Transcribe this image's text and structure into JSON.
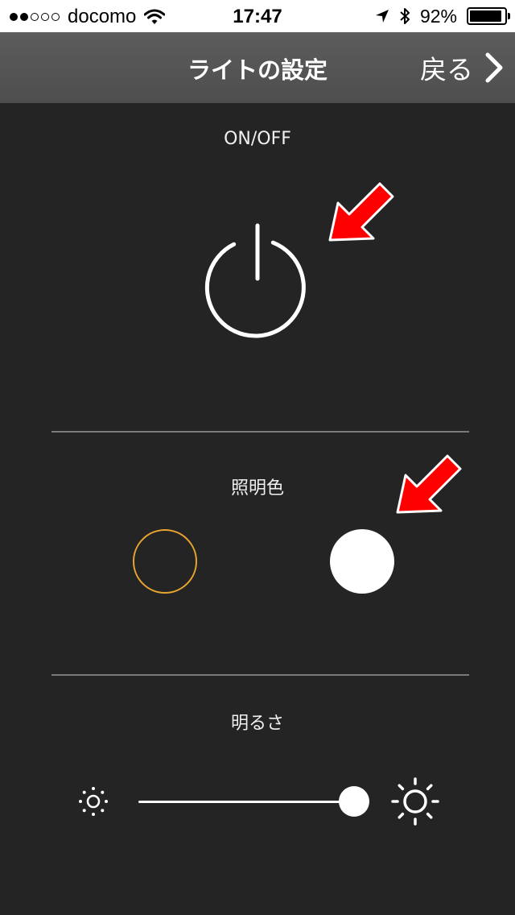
{
  "status_bar": {
    "signal_bars_filled": 2,
    "signal_bars_total": 5,
    "carrier": "docomo",
    "time": "17:47",
    "battery_percent_label": "92%",
    "battery_level": 0.92,
    "icons": [
      "wifi-icon",
      "location-arrow-icon",
      "bluetooth-icon",
      "battery-icon"
    ]
  },
  "nav": {
    "title": "ライトの設定",
    "back_label": "戻る",
    "back_icon": "chevron-right-icon"
  },
  "sections": {
    "power": {
      "title": "ON/OFF",
      "icon": "power-icon"
    },
    "color": {
      "title": "照明色",
      "options": [
        {
          "name": "warm",
          "color": "#e8a431",
          "style": "outline"
        },
        {
          "name": "white",
          "color": "#ffffff",
          "style": "filled"
        }
      ]
    },
    "brightness": {
      "title": "明るさ",
      "value": 0.91,
      "min_icon": "sun-small-icon",
      "max_icon": "sun-large-icon"
    }
  },
  "annotations": {
    "arrow_color": "#ff0000",
    "count": 2
  },
  "colors": {
    "background": "#242424",
    "navbar": "#555555",
    "divider": "#7a7a7a"
  }
}
